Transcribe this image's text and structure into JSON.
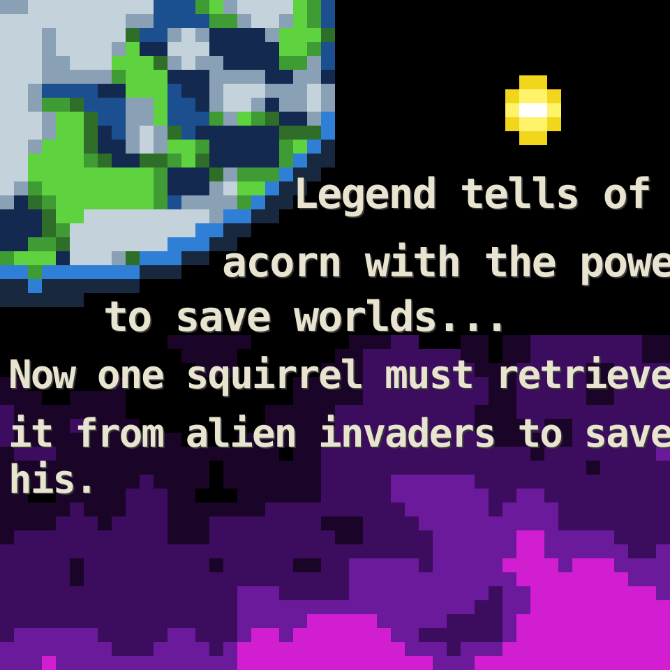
{
  "intro": {
    "lines": [
      "Legend tells of an",
      "acorn with the power",
      "to save worlds...",
      "Now one squirrel must retrieve",
      "it from alien invaders to save",
      "his."
    ]
  },
  "colors": {
    "space": "#000000",
    "text": "#e8e4d0",
    "text_shadow": "#3a3a3a",
    "ocean_outer": "#13294f",
    "ocean": "#1c4f8f",
    "ocean_edge": "#2f7fd6",
    "atmosphere": "#17283f",
    "land_dark": "#2e6e28",
    "land": "#3f9c34",
    "land_light": "#5ed23f",
    "cloud_dark": "#8aa0b4",
    "cloud_light": "#c4d2dc",
    "star_core": "#ffffff",
    "star_glow": "#fff36a",
    "star_outer": "#f2d61c",
    "nebula_dark": "#1a0528",
    "nebula_mid": "#3c0d5e",
    "nebula_bright": "#6b1a9c",
    "nebula_hot": "#d01ed0"
  },
  "scene": {
    "icons": [
      "planet-earth-icon",
      "star-icon",
      "nebula"
    ]
  }
}
